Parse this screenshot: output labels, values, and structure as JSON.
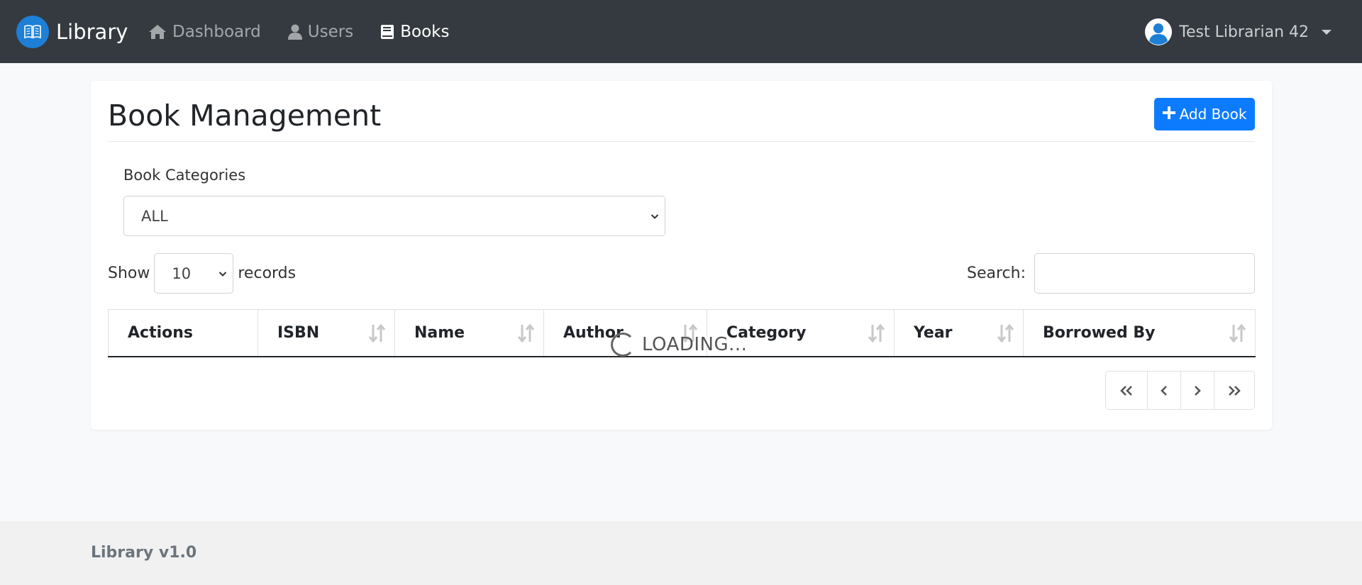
{
  "navbar": {
    "brand": "Library",
    "links": [
      {
        "label": "Dashboard",
        "icon": "home-icon",
        "active": false
      },
      {
        "label": "Users",
        "icon": "user-icon",
        "active": false
      },
      {
        "label": "Books",
        "icon": "book-icon",
        "active": true
      }
    ],
    "user": {
      "name": "Test Librarian 42",
      "icon": "user-circle-icon"
    }
  },
  "card": {
    "title": "Book Management",
    "add_button": "Add Book",
    "add_icon": "plus-icon"
  },
  "filters": {
    "category_label": "Book Categories",
    "category_value": "ALL",
    "show_label": "Show",
    "page_length": "10",
    "records_label": "records",
    "search_label": "Search:",
    "search_value": ""
  },
  "table": {
    "columns": [
      "Actions",
      "ISBN",
      "Name",
      "Author",
      "Category",
      "Year",
      "Borrowed By"
    ],
    "loading_text": "LOADING..."
  },
  "pagination": {
    "buttons": [
      "first-page",
      "previous-page",
      "next-page",
      "last-page"
    ]
  },
  "footer": {
    "text": "Library v1.0"
  },
  "colors": {
    "navbar": "#343a40",
    "primary": "#0d7bfe",
    "background": "#f8f9fa",
    "footer": "#f1f1f1"
  }
}
